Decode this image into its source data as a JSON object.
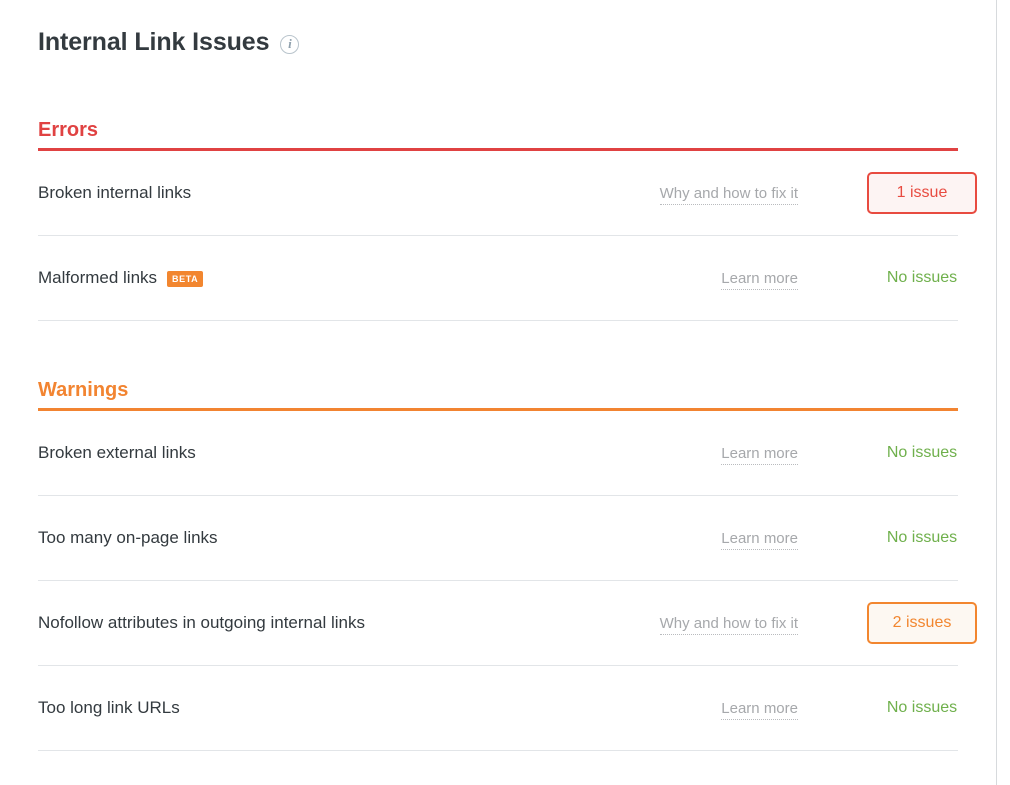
{
  "page": {
    "title": "Internal Link Issues",
    "info_icon": "info-circle-icon"
  },
  "sections": [
    {
      "id": "errors",
      "heading": "Errors",
      "accent": "#e04242",
      "rows": [
        {
          "label": "Broken internal links",
          "badge": null,
          "link": "Why and how to fix it",
          "status_type": "pill-red",
          "status": "1 issue"
        },
        {
          "label": "Malformed links",
          "badge": "BETA",
          "link": "Learn more",
          "status_type": "ok",
          "status": "No issues"
        }
      ]
    },
    {
      "id": "warnings",
      "heading": "Warnings",
      "accent": "#f28431",
      "rows": [
        {
          "label": "Broken external links",
          "badge": null,
          "link": "Learn more",
          "status_type": "ok",
          "status": "No issues"
        },
        {
          "label": "Too many on-page links",
          "badge": null,
          "link": "Learn more",
          "status_type": "ok",
          "status": "No issues"
        },
        {
          "label": "Nofollow attributes in outgoing internal links",
          "badge": null,
          "link": "Why and how to fix it",
          "status_type": "pill-orange",
          "status": "2 issues"
        },
        {
          "label": "Too long link URLs",
          "badge": null,
          "link": "Learn more",
          "status_type": "ok",
          "status": "No issues"
        }
      ]
    }
  ],
  "colors": {
    "error": "#e04242",
    "warning": "#f28431",
    "ok_green": "#6fb04c",
    "text": "#333a3f",
    "muted": "#a6a8ab",
    "divider": "#e2e5e8"
  }
}
